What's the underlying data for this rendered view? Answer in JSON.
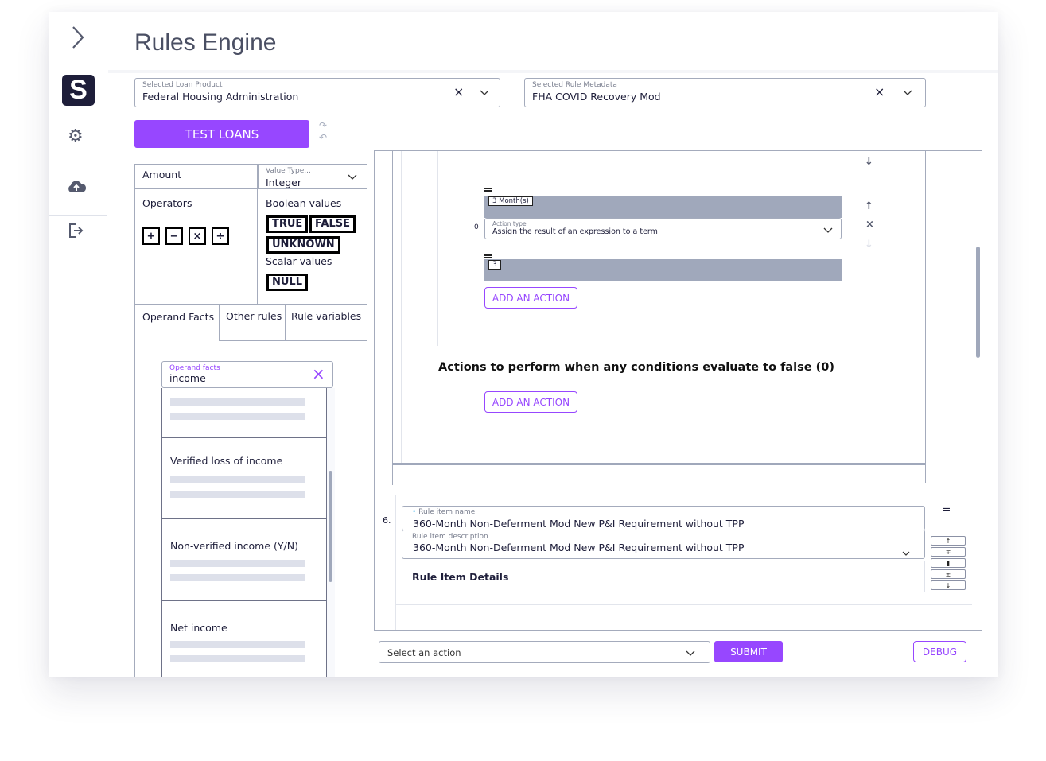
{
  "app": {
    "title": "Rules Engine"
  },
  "sidebar": {
    "icons": [
      "chevron-right-icon",
      "logo-icon",
      "gear-icon",
      "cloud-upload-icon",
      "logout-icon"
    ],
    "logo_letter": "S"
  },
  "colors": {
    "accent": "#9747ff",
    "navy": "#1e1e3a",
    "gray_band": "#a0a8bb"
  },
  "selectors": {
    "loan_product": {
      "label": "Selected Loan Product",
      "value": "Federal Housing Administration"
    },
    "rule_metadata": {
      "label": "Selected Rule Metadata",
      "value": "FHA COVID Recovery Mod"
    }
  },
  "toolbar": {
    "test_loans": "TEST LOANS"
  },
  "builder": {
    "amount_label": "Amount",
    "value_type": {
      "label": "Value Type...",
      "value": "Integer"
    },
    "operators_label": "Operators",
    "operators": [
      "+",
      "−",
      "×",
      "÷"
    ],
    "boolean_label": "Boolean values",
    "booleans": [
      "TRUE",
      "FALSE",
      "UNKNOWN"
    ],
    "scalar_label": "Scalar values",
    "scalars": [
      "NULL"
    ],
    "tabs": [
      "Operand Facts",
      "Other rules",
      "Rule variables"
    ],
    "facts_search": {
      "label": "Operand facts",
      "value": "income"
    },
    "facts": [
      "Verified loss of income",
      "Non-verified income (Y/N)",
      "Net income"
    ]
  },
  "editor": {
    "chip1": "3 Month(s)",
    "action_index": "0",
    "action_type": {
      "label": "Action type",
      "value": "Assign the result of an expression to a term"
    },
    "chip2": "3",
    "add_action": "ADD AN ACTION",
    "false_heading": "Actions to perform when any conditions evaluate to false (0)",
    "rule_item": {
      "number": "6.",
      "name_label": "Rule item name",
      "name": "360-Month Non-Deferment Mod New P&I Requirement without TPP",
      "desc_label": "Rule item description",
      "desc": "360-Month Non-Deferment Mod New P&I Requirement without TPP",
      "details": "Rule Item Details"
    }
  },
  "footer": {
    "select_placeholder": "Select an action",
    "submit": "SUBMIT",
    "debug": "DEBUG"
  }
}
